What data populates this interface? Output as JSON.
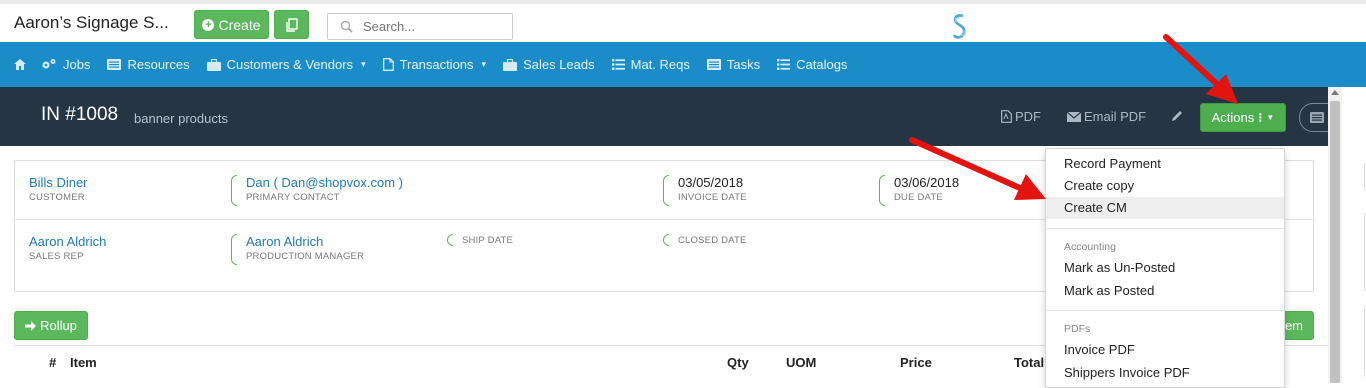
{
  "app": {
    "title": "Aaron’s Signage S..."
  },
  "topbar": {
    "create_label": "Create",
    "search_placeholder": "Search..."
  },
  "nav": {
    "items": [
      {
        "label": "Jobs",
        "icon": "cogs-icon"
      },
      {
        "label": "Resources",
        "icon": "list-icon"
      },
      {
        "label": "Customers & Vendors",
        "icon": "briefcase-icon",
        "caret": "▾"
      },
      {
        "label": "Transactions",
        "icon": "document-icon",
        "caret": "▾"
      },
      {
        "label": "Sales Leads",
        "icon": "briefcase-icon"
      },
      {
        "label": "Mat. Reqs",
        "icon": "list-icon"
      },
      {
        "label": "Tasks",
        "icon": "list-icon"
      },
      {
        "label": "Catalogs",
        "icon": "list-icon"
      }
    ]
  },
  "header": {
    "invoice_number": "IN #1008",
    "subtitle": "banner products",
    "pdf_label": "PDF",
    "email_pdf_label": "Email PDF",
    "actions_label": "Actions"
  },
  "info": {
    "customer": {
      "value": "Bills Diner",
      "label": "CUSTOMER"
    },
    "primary_contact": {
      "value": "Dan ( Dan@shopvox.com )",
      "label": "PRIMARY CONTACT"
    },
    "invoice_date": {
      "value": "03/05/2018",
      "label": "INVOICE DATE"
    },
    "due_date": {
      "value": "03/06/2018",
      "label": "DUE DATE"
    },
    "sales_rep": {
      "value": "Aaron Aldrich",
      "label": "SALES REP"
    },
    "production_manager": {
      "value": "Aaron Aldrich",
      "label": "PRODUCTION MANAGER"
    },
    "ship_date": {
      "label": "SHIP DATE"
    },
    "closed_date": {
      "label": "CLOSED DATE"
    }
  },
  "toolbar": {
    "rollup_label": "Rollup",
    "add_item_label": "em"
  },
  "table": {
    "headers": [
      "#",
      "Item",
      "Qty",
      "UOM",
      "Price",
      "Total"
    ]
  },
  "dropdown": {
    "items_top": [
      "Record Payment",
      "Create copy",
      "Create CM"
    ],
    "accounting_header": "Accounting",
    "accounting_items": [
      "Mark as Un-Posted",
      "Mark as Posted"
    ],
    "pdfs_header": "PDFs",
    "pdf_items": [
      "Invoice PDF",
      "Shippers Invoice PDF"
    ],
    "highlighted": "Create CM"
  },
  "colors": {
    "nav_blue": "#1a8cc8",
    "header_dark": "#263544",
    "green": "#5cb85c",
    "link_blue": "#1f7ab8",
    "arrow_red": "#e3140f"
  }
}
